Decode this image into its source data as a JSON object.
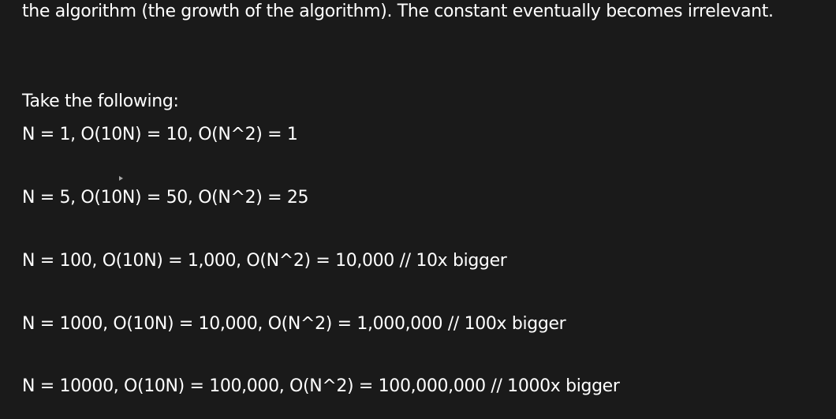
{
  "document": {
    "lines": [
      "the algorithm (the growth of the algorithm). The constant eventually becomes irrelevant.",
      "Take the following:",
      "N = 1, O(10N) = 10, O(N^2) = 1",
      "N = 5, O(10N) = 50, O(N^2) = 25",
      "N = 100, O(10N) = 1,000, O(N^2) = 10,000 // 10x bigger",
      "N = 1000, O(10N) = 10,000, O(N^2) = 1,000,000 // 100x bigger",
      "N = 10000, O(10N) = 100,000, O(N^2) = 100,000,000 // 1000x bigger"
    ]
  },
  "colors": {
    "background": "#1a1a1a",
    "text": "#ffffff",
    "cursor": "#a8a8a8"
  },
  "icons": {
    "cursor": "mouse-cursor-icon"
  }
}
